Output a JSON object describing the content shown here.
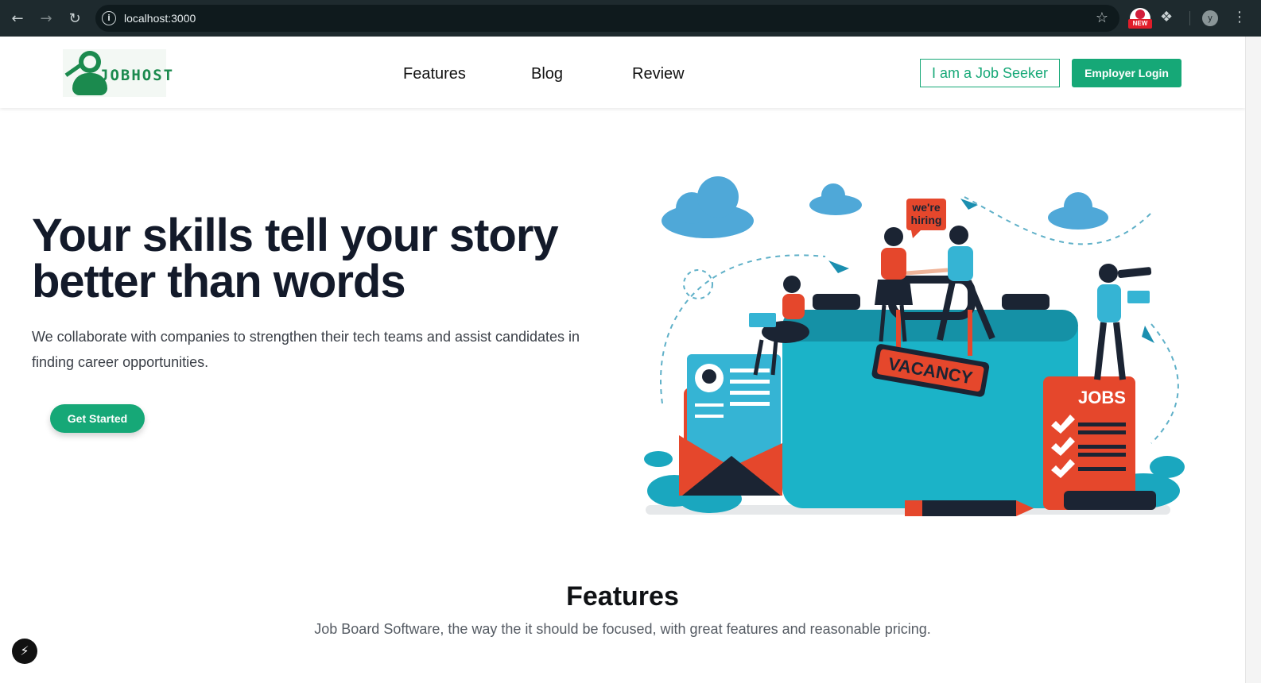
{
  "browser": {
    "url": "localhost:3000",
    "extension_badge": "NEW",
    "profile_initial": "y",
    "icons": {
      "back": "arrow-left-icon",
      "forward": "arrow-right-icon",
      "reload": "reload-icon",
      "site_info": "info-icon",
      "bookmark": "star-icon",
      "extensions": "puzzle-icon",
      "menu": "kebab-menu-icon"
    }
  },
  "header": {
    "logo_text": "JOBHOST",
    "nav": [
      "Features",
      "Blog",
      "Review"
    ],
    "job_seeker_label": "I am a Job Seeker",
    "employer_login_label": "Employer Login"
  },
  "hero": {
    "title_line1": "Your skills tell your story",
    "title_line2": "better than words",
    "subtitle": "We collaborate with companies to strengthen their tech teams and assist candidates in finding career opportunities.",
    "cta_label": "Get Started",
    "illustration": {
      "hiring_sign": [
        "we're",
        "hiring"
      ],
      "vacancy_tag": "VACANCY",
      "jobs_label": "JOBS"
    }
  },
  "features": {
    "title": "Features",
    "subtitle": "Job Board Software, the way the it should be focused, with great features and reasonable pricing."
  },
  "colors": {
    "brand": "#16a877",
    "logo_green": "#1b8a4e",
    "heading": "#131a2a",
    "teal": "#1bb3c8",
    "accent_red": "#e5472c"
  }
}
